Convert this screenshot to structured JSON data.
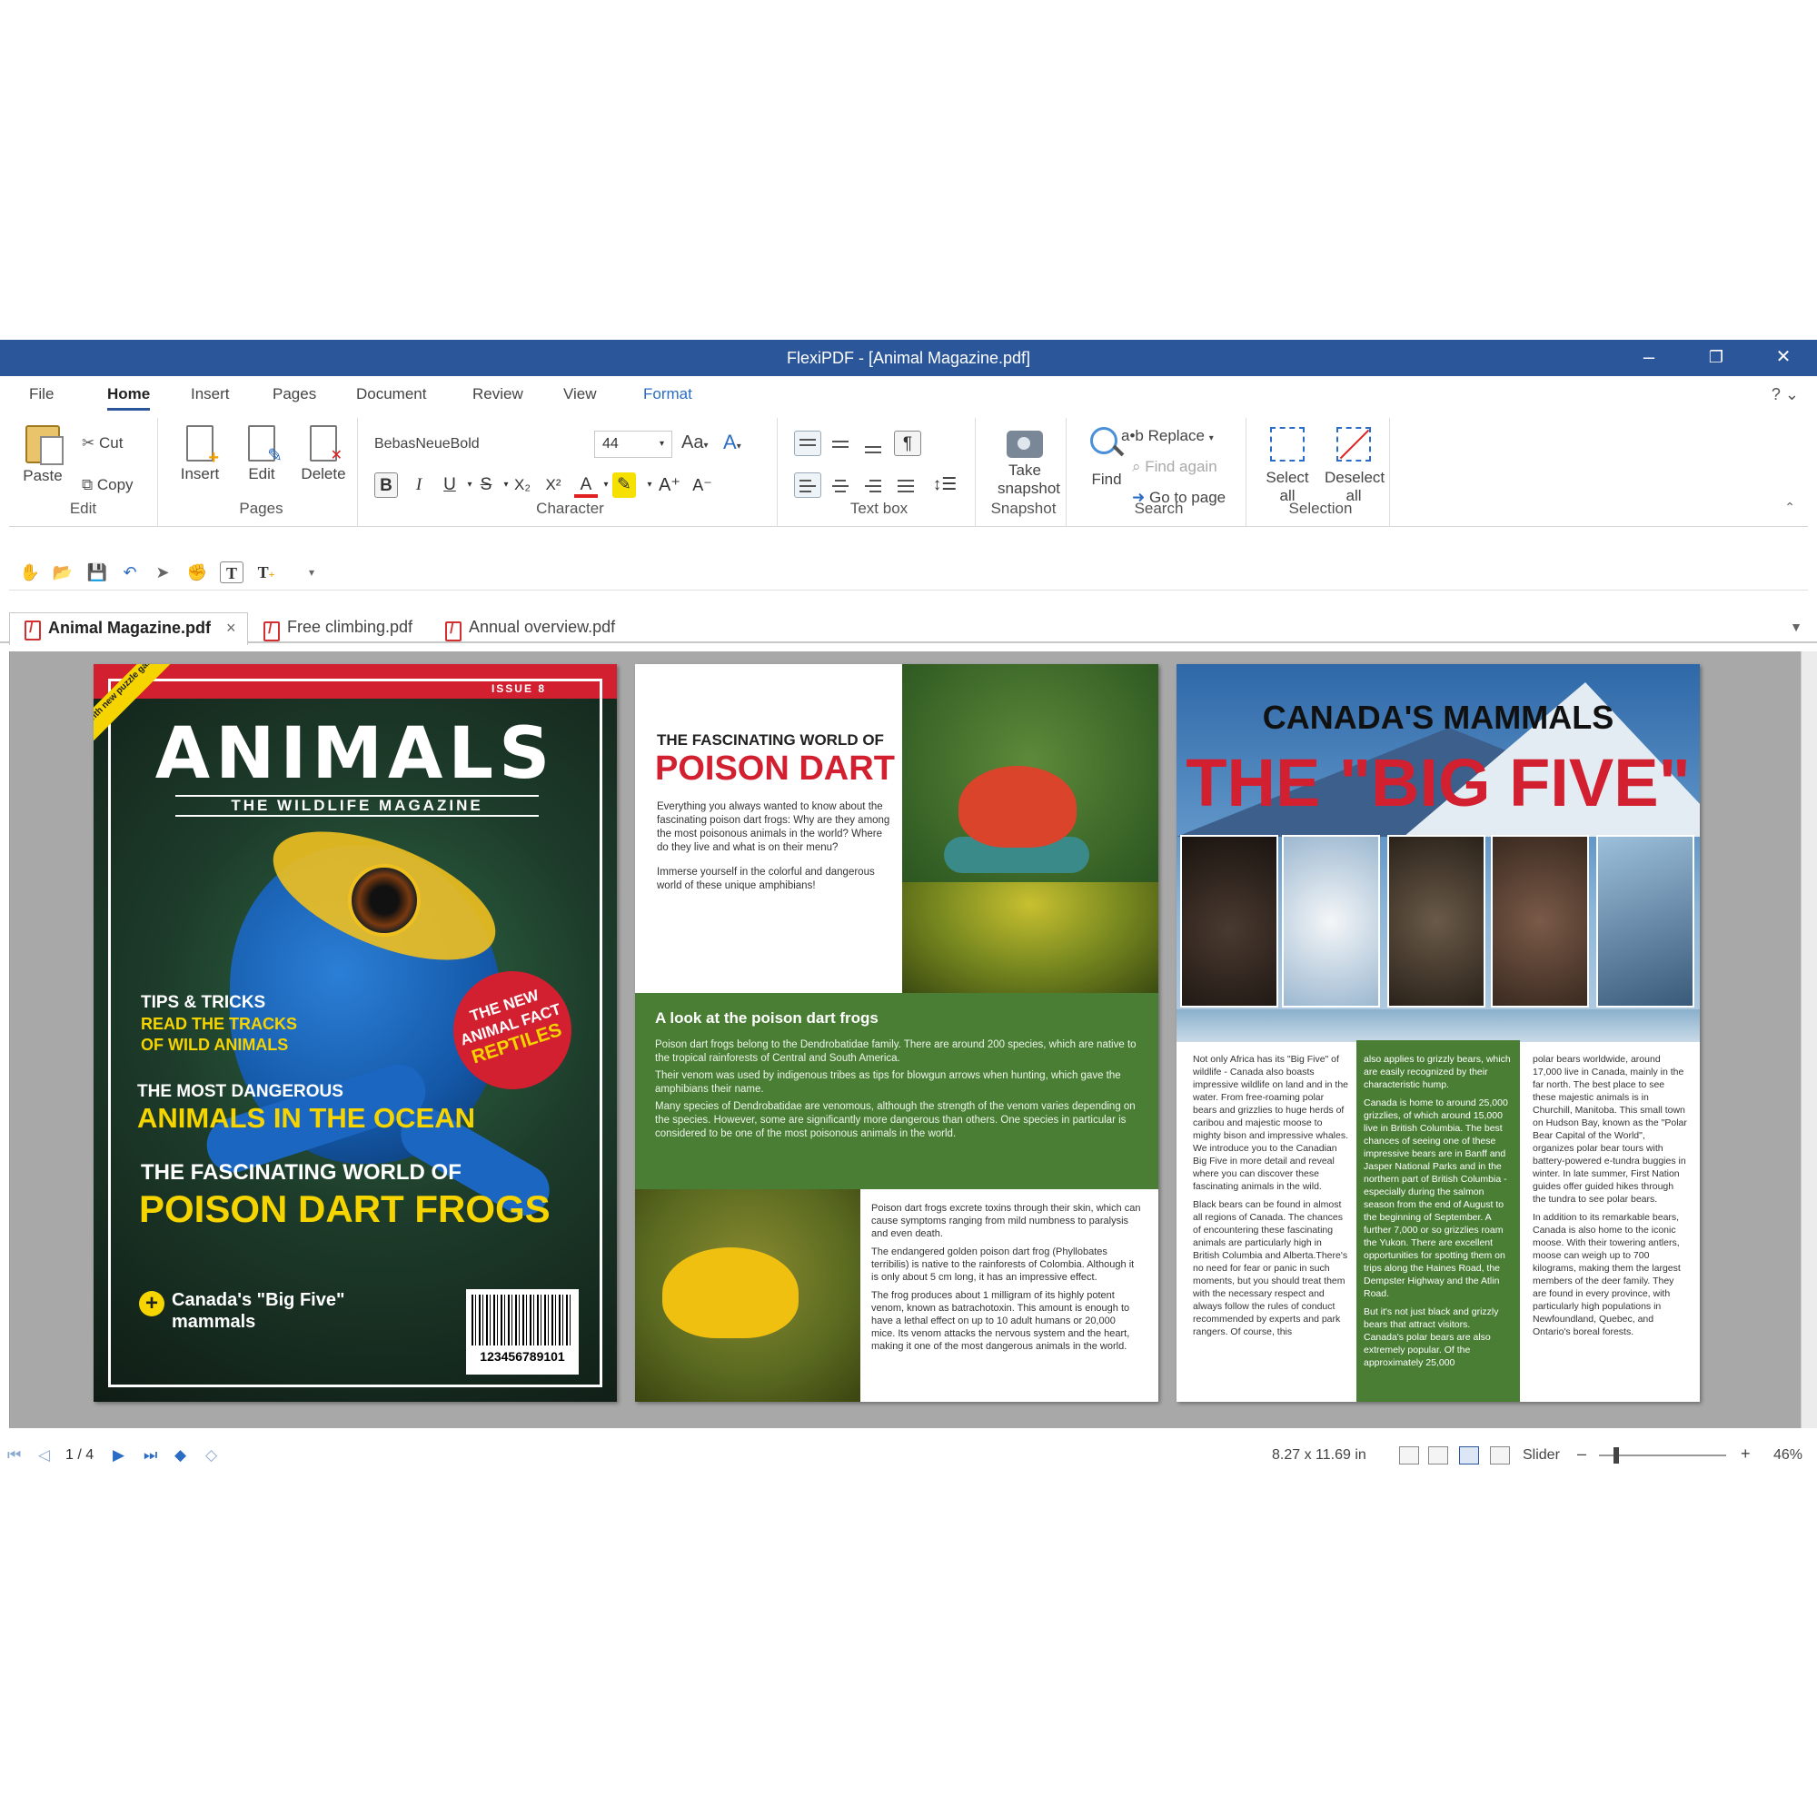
{
  "window": {
    "title": "FlexiPDF - [Animal Magazine.pdf]",
    "minimize": "–",
    "restore": "❐",
    "close": "✕"
  },
  "menu": {
    "items": [
      "File",
      "Home",
      "Insert",
      "Pages",
      "Document",
      "Review",
      "View",
      "Format"
    ],
    "active": "Home",
    "help": "? ⌄"
  },
  "ribbon": {
    "edit": {
      "label": "Edit",
      "paste": "Paste",
      "cut": "Cut",
      "copy": "Copy"
    },
    "pages": {
      "label": "Pages",
      "insert": "Insert",
      "edit": "Edit",
      "delete": "Delete"
    },
    "character": {
      "label": "Character",
      "font": "BebasNeueBold",
      "size": "44",
      "bold": "B",
      "italic": "I",
      "underline": "U",
      "strike": "S",
      "subscript": "X₂",
      "superscript": "X²",
      "font_color": "A",
      "grow": "A⁺",
      "shrink": "A⁻",
      "case": "Aa",
      "spacing": "A"
    },
    "textbox": {
      "label": "Text box",
      "pilcrow": "¶"
    },
    "snapshot": {
      "label": "Snapshot",
      "take": "Take snapshot"
    },
    "search": {
      "label": "Search",
      "find": "Find",
      "replace": "a•b Replace",
      "find_again": "Find again",
      "goto": "Go to page"
    },
    "selection": {
      "label": "Selection",
      "select_all": "Select all",
      "deselect_all": "Deselect all"
    },
    "collapse": "⌃"
  },
  "quick_access": {
    "icons": [
      "hand-icon",
      "open-folder-icon",
      "save-icon",
      "undo-icon",
      "pointer-icon",
      "grab-icon",
      "text-tool-icon",
      "add-text-icon",
      "customize-icon"
    ]
  },
  "tabs": [
    {
      "label": "Animal Magazine.pdf",
      "close": "×"
    },
    {
      "label": "Free climbing.pdf"
    },
    {
      "label": "Annual overview.pdf"
    }
  ],
  "tabs_menu": "▼",
  "cover": {
    "corner": "With new puzzle game",
    "issue": "ISSUE 8",
    "title": "ANIMALS",
    "subtitle": "THE WILDLIFE MAGAZINE",
    "tips1": "TIPS & TRICKS",
    "tips2": "READ THE TRACKS",
    "tips3": "OF WILD ANIMALS",
    "badge1": "THE NEW",
    "badge2": "ANIMAL FACT",
    "badge3": "REPTILES",
    "dangerous1": "THE MOST DANGEROUS",
    "dangerous2": "ANIMALS IN THE OCEAN",
    "fascinating1": "THE FASCINATING WORLD OF",
    "fascinating2": "POISON DART FROGS",
    "canada1": "Canada's \"Big Five\"",
    "canada2": "mammals",
    "barcode": "123456789101"
  },
  "frogs_page": {
    "title1": "THE FASCINATING WORLD OF",
    "title2": "POISON DART FROGS",
    "intro1": "Everything you always wanted to know about the fascinating poison dart frogs: Why are they among the most poisonous animals in the world? Where do they live and what is on their menu?",
    "intro2": "Immerse yourself in the colorful and dangerous world of these unique amphibians!",
    "band_title": "A look at the poison dart frogs",
    "band_p1": "Poison dart frogs belong to the Dendrobatidae family. There are around 200 species, which are native to the tropical rainforests of Central and South America.",
    "band_p2": "Their venom was used by indigenous tribes as tips for blowgun arrows when hunting, which gave the amphibians their name.",
    "band_p3": "Many species of Dendrobatidae are venomous, although the strength of the venom varies depending on the species. However, some are significantly more dangerous than others. One species in particular is considered to be one of the most poisonous animals in the world.",
    "body1": "Poison dart frogs excrete toxins through their skin, which can cause symptoms ranging from mild numbness to paralysis and even death.",
    "body2": "The endangered golden poison dart frog (Phyllobates terribilis) is native to the rainforests of Colombia. Although it is only about 5 cm long, it has an impressive effect.",
    "body3": "The frog produces about 1 milligram of its highly potent venom, known as batrachotoxin. This amount is enough to have a lethal effect on up to 10 adult humans or 20,000 mice. Its venom attacks the nervous system and the heart, making it one of the most dangerous animals in the world."
  },
  "canada_page": {
    "title1": "CANADA'S MAMMALS",
    "title2": "THE \"BIG FIVE\"",
    "col1_p1": "Not only Africa has its \"Big Five\" of wildlife - Canada also boasts impressive wildlife on land and in the water. From free-roaming polar bears and grizzlies to huge herds of caribou and majestic moose to mighty bison and impressive whales. We introduce you to the Canadian Big Five in more detail and reveal where you can discover these fascinating animals in the wild.",
    "col1_p2": "Black bears can be found in almost all regions of Canada. The chances of encountering these fascinating animals are particularly high in British Columbia and Alberta.There's no need for fear or panic in such moments, but you should treat them with the necessary respect and always follow the rules of conduct recommended by experts and park rangers. Of course, this",
    "col2_p1": "also applies to grizzly bears, which are easily recognized by their characteristic hump.",
    "col2_p2": "Canada is home to around 25,000 grizzlies, of which around 15,000 live in British Columbia. The best chances of seeing one of these impressive bears are in Banff and Jasper National Parks and in the northern part of British Columbia - especially during the salmon season from the end of August to the beginning of September. A further 7,000 or so grizzlies roam the Yukon. There are excellent opportunities for spotting them on trips along the Haines Road, the Dempster Highway and the Atlin Road.",
    "col2_p3": "But it's not just black and grizzly bears that attract visitors. Canada's polar bears are also extremely popular. Of the approximately 25,000",
    "col3_p1": "polar bears worldwide, around 17,000 live in Canada, mainly in the far north. The best place to see these majestic animals is in Churchill, Manitoba. This small town on Hudson Bay, known as the \"Polar Bear Capital of the World\", organizes polar bear tours with battery-powered e-tundra buggies in winter. In late summer, First Nation guides offer guided hikes through the tundra to see polar bears.",
    "col3_p2": "In addition to its remarkable bears, Canada is also home to the iconic moose. With their towering antlers, moose can weigh up to 700 kilograms, making them the largest members of the deer family. They are found in every province, with particularly high populations in Newfoundland, Quebec, and Ontario's boreal forests."
  },
  "status": {
    "page": "1 / 4",
    "page_size": "8.27 x 11.69 in",
    "slider_label": "Slider",
    "zoom_minus": "–",
    "zoom_plus": "+",
    "zoom": "46%",
    "zoom_fraction": 0.46
  }
}
